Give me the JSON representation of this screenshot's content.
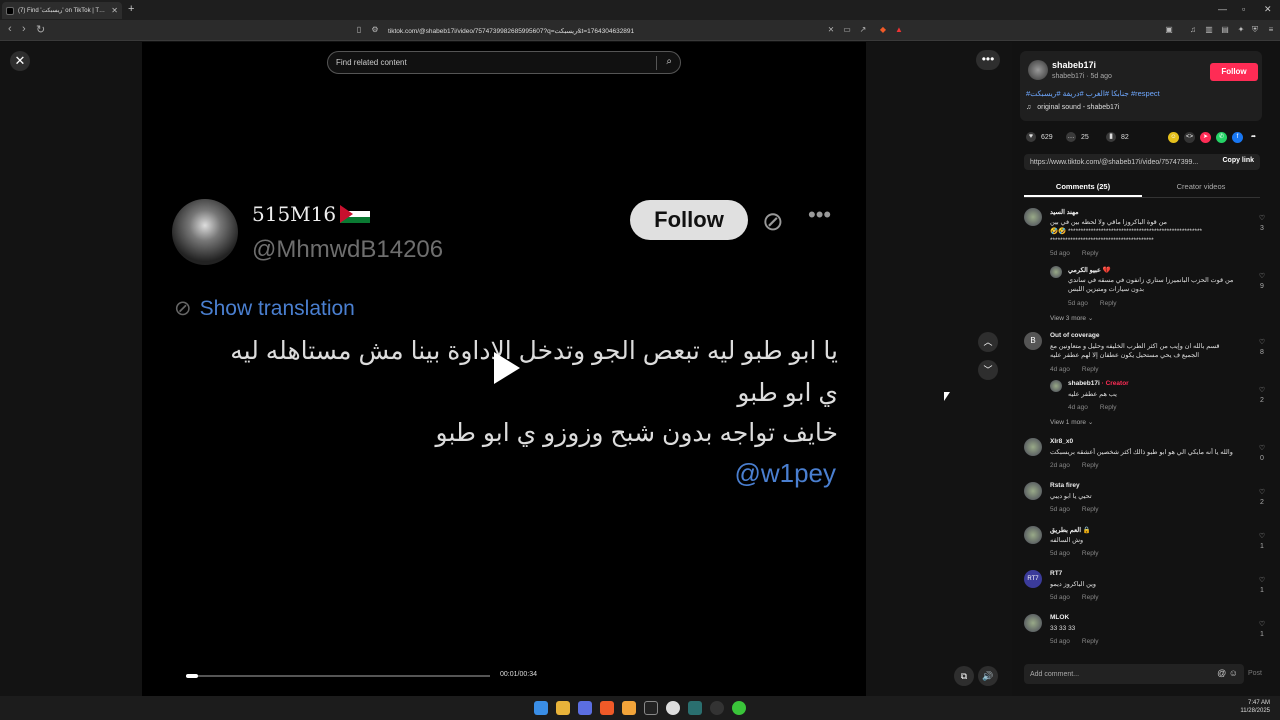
{
  "browser": {
    "tab_title": "(7) Find 'ريسبكت' on TikTok | T…",
    "url": "tiktok.com/@shabeb17i/video/7574739982685995607?q=ريسبكت&t=1764304632891"
  },
  "video": {
    "search_placeholder": "Find related content",
    "time": "00:01/00:34",
    "progress": 0.04,
    "tweet": {
      "name": "515M16",
      "handle": "@MhmwdB14206",
      "follow": "Follow",
      "show_translation": "Show translation",
      "line1": "يا ابو طبو ليه تبعص الجو وتدخل الاداوة بينا مش مستاهله ليه",
      "line2": "ي ابو طبو",
      "line3": "خايف تواجه بدون شبح وزوزو ي ابو طبو",
      "mention": "@w1pey"
    }
  },
  "creator": {
    "name": "shabeb17i",
    "sub": "shabeb17i · 5d ago",
    "follow": "Follow",
    "tags": "#جنابكا #الغرب #دريفة #ريسبكت #respect",
    "sound": "original sound - shabeb17i"
  },
  "stats": {
    "likes": "629",
    "comments": "25",
    "saves": "82"
  },
  "share": {
    "link": "https://www.tiktok.com/@shabeb17i/video/75747399...",
    "copy": "Copy link"
  },
  "tabs": {
    "comments": "Comments (25)",
    "videos": "Creator videos"
  },
  "comments": [
    {
      "user": "مهند السيد",
      "text": "من قوة الباكروزا ماقي ولا لحظه بين في بين *****************************************************  🤣🤣 *****************************************",
      "time": "5d ago",
      "reply": "Reply",
      "likes": "3"
    },
    {
      "user": "عبيو الكرمي 💔",
      "text": "من قوت الحزب البانميرزا ستاري زانفون في مسقه في ساندي بدون سيارات ومتبزين اللبس",
      "time": "5d ago",
      "reply": "Reply",
      "likes": "9"
    },
    {
      "view_more": "View 3 more ⌄"
    },
    {
      "user": "Out of coverage",
      "text": "قسم بالله ان وإيب من اكثر الطرب الخليفه وحليل و متعاونين مع الجميع ف يحي مستحيل يكون عطفان إلا لهم عطفر عليه",
      "time": "4d ago",
      "reply": "Reply",
      "likes": "8"
    },
    {
      "user": "shabeb17i",
      "creator": " · Creator",
      "text": "يب هم عطفر عليه",
      "time": "4d ago",
      "reply": "Reply",
      "likes": "2"
    },
    {
      "view_more": "View 1 more ⌄"
    },
    {
      "user": "Xlr8_x0",
      "text": "والله يا أنه مايكي الي هو ابو طبو ذالك أكثر شخصين أعشقه بريسبكت",
      "time": "2d ago",
      "reply": "Reply",
      "likes": "0"
    },
    {
      "user": "Rsta firey",
      "text": "تحيي يا ابو ديبي",
      "time": "5d ago",
      "reply": "Reply",
      "likes": "2"
    },
    {
      "user": "العم بطريق 🔒",
      "text": "وش السالفه",
      "time": "5d ago",
      "reply": "Reply",
      "likes": "1"
    },
    {
      "user": "RT7",
      "text": "وين الباكروز ديمو",
      "time": "5d ago",
      "reply": "Reply",
      "likes": "1"
    },
    {
      "user": "MLOK",
      "text": "33 33 33",
      "time": "5d ago",
      "reply": "Reply",
      "likes": "1"
    }
  ],
  "footer": {
    "add_comment": "Add comment...",
    "post": "Post"
  },
  "taskbar": {
    "time": "7:47 AM",
    "date": "11/28/2025"
  }
}
